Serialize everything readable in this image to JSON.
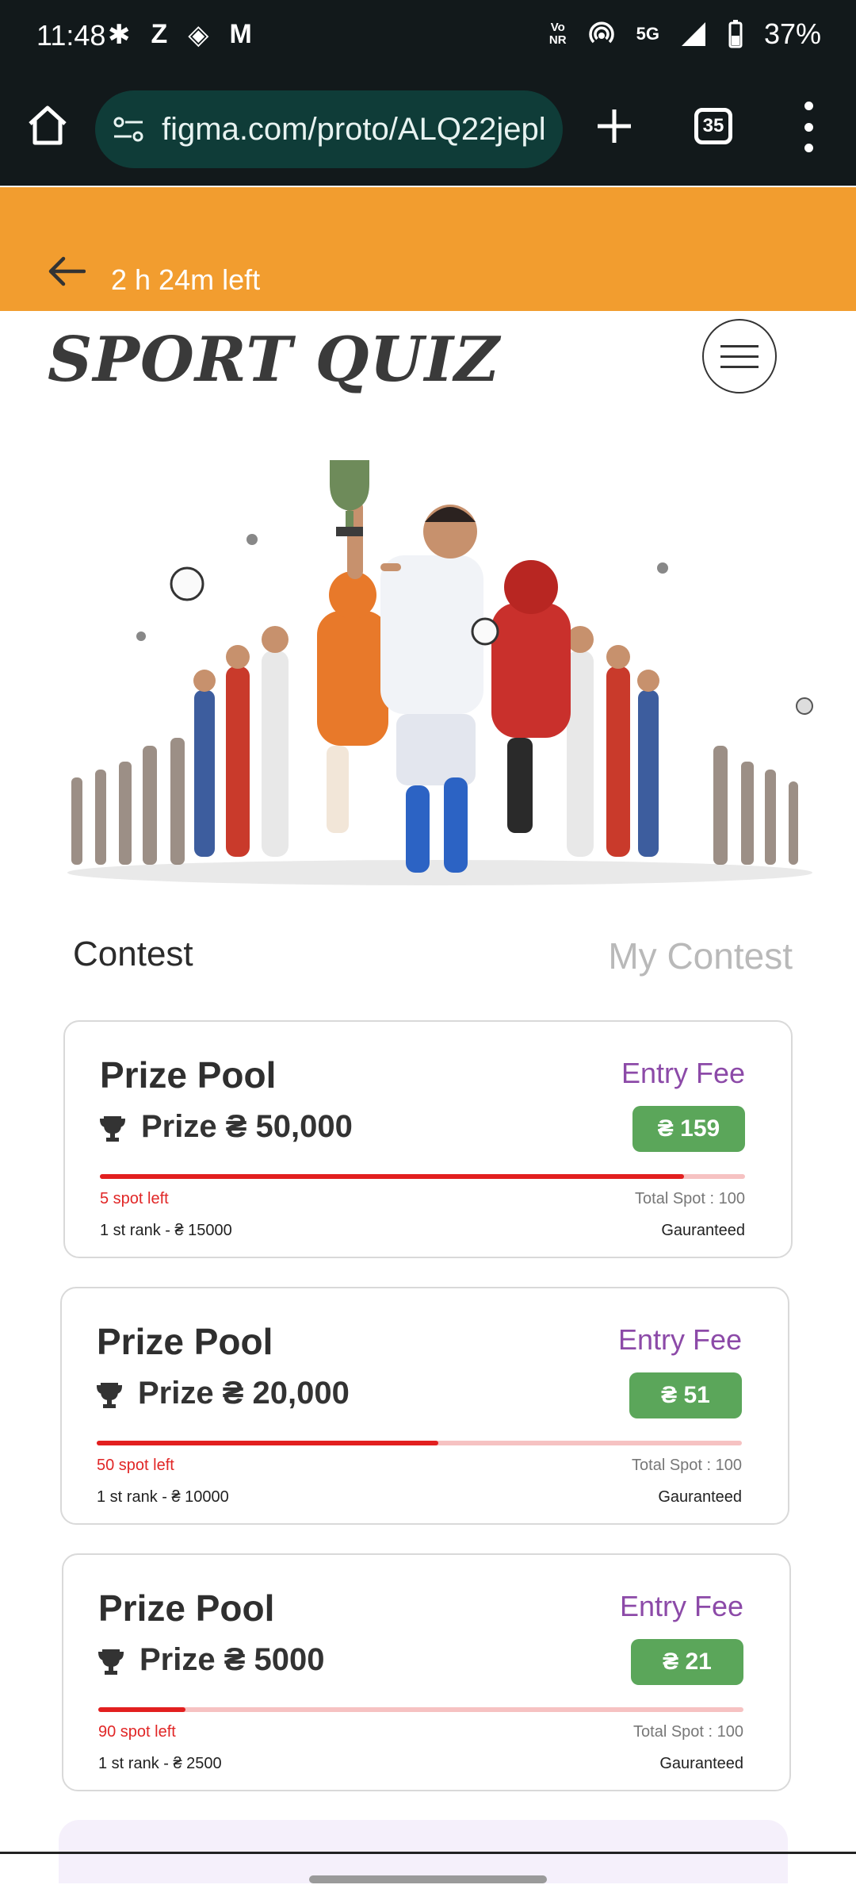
{
  "status_bar": {
    "time": "11:48",
    "left_icons": [
      "slack-icon",
      "z-icon",
      "app-icon",
      "gmail-icon"
    ],
    "volte": "Vo LTE NR",
    "network": "5G",
    "battery": "37%"
  },
  "browser": {
    "url": "figma.com/proto/ALQ22jepl",
    "tab_count": "35"
  },
  "header": {
    "time_left": "2 h 24m left",
    "accent": "#f29d2f"
  },
  "app": {
    "logo": "SPORT QUIZ"
  },
  "tabs": {
    "contest": "Contest",
    "my_contest": "My Contest"
  },
  "contests": [
    {
      "title": "Prize Pool",
      "entry_label": "Entry Fee",
      "prize": "Prize ₴ 50,000",
      "fee": "₴ 159",
      "spots_left": "5 spot left",
      "total_spot": "Total Spot : 100",
      "first_rank": "1 st rank - ₴ 15000",
      "guaranteed": "Gauranteed",
      "fill_fraction": 0.905
    },
    {
      "title": "Prize Pool",
      "entry_label": "Entry Fee",
      "prize": "Prize ₴ 20,000",
      "fee": "₴ 51",
      "spots_left": "50 spot left",
      "total_spot": "Total Spot : 100",
      "first_rank": "1 st rank - ₴ 10000",
      "guaranteed": "Gauranteed",
      "fill_fraction": 0.53
    },
    {
      "title": "Prize Pool",
      "entry_label": "Entry Fee",
      "prize": "Prize ₴ 5000",
      "fee": "₴ 21",
      "spots_left": "90 spot left",
      "total_spot": "Total Spot : 100",
      "first_rank": "1 st rank - ₴ 2500",
      "guaranteed": "Gauranteed",
      "fill_fraction": 0.135
    }
  ],
  "colors": {
    "entry_fee_text": "#8c4aa8",
    "fee_button": "#5ba65a",
    "progress": "#e21f1f",
    "status_bar": "#12191b",
    "url_pill": "#0f3c38"
  }
}
